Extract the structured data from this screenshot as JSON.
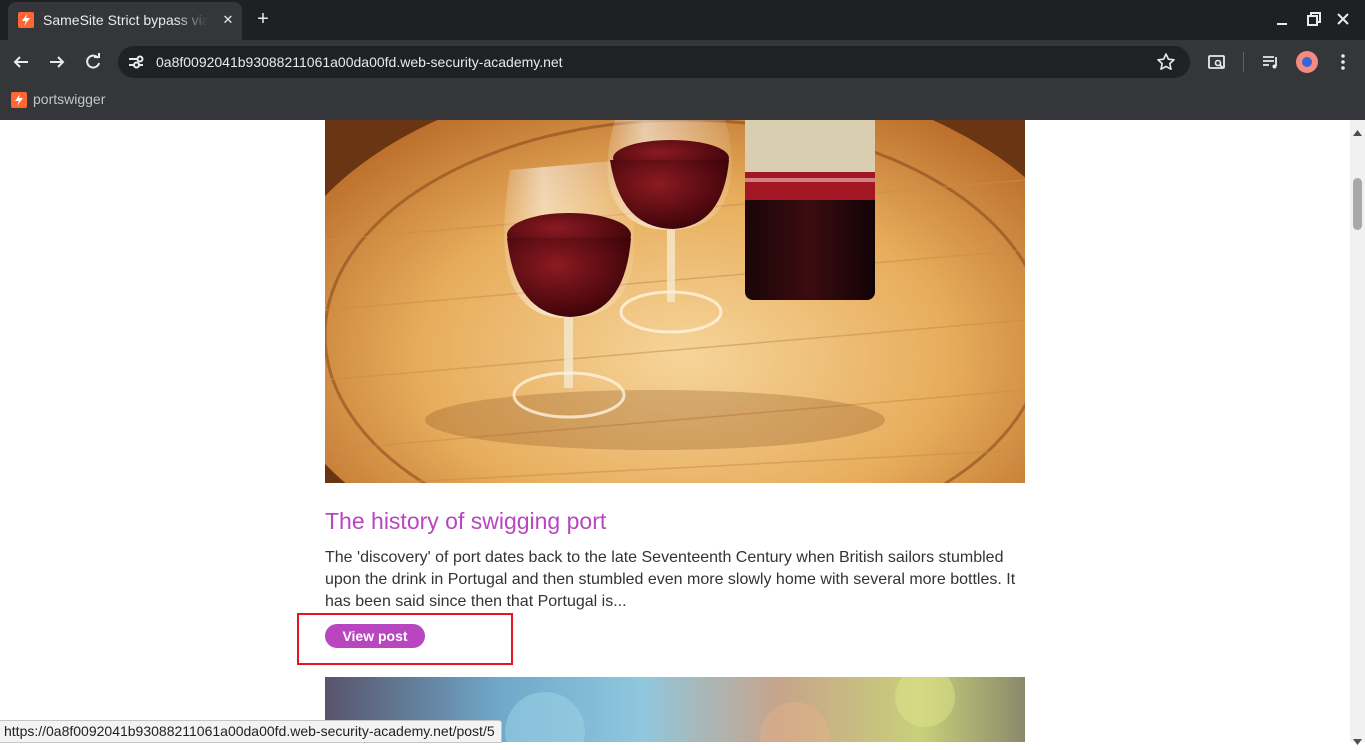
{
  "browser": {
    "tab": {
      "title": "SameSite Strict bypass via",
      "close_glyph": "✕"
    },
    "new_tab_glyph": "+",
    "address": {
      "url": "0a8f0092041b93088211061a00da00fd.web-security-academy.net"
    },
    "bookmarks": [
      {
        "label": "portswigger",
        "icon": "portswigger-icon"
      }
    ],
    "status_url": "https://0a8f0092041b93088211061a00da00fd.web-security-academy.net/post/5"
  },
  "post": {
    "title": "The history of swigging port",
    "summary": "The 'discovery' of port dates back to the late Seventeenth Century when British sailors stumbled upon the drink in Portugal and then stumbled even more slowly home with several more bottles. It has been said since then that Portugal is...",
    "button_label": "View post"
  },
  "colors": {
    "accent": "#b946c0",
    "highlight": "#e8141f",
    "chrome_dark": "#1f2023",
    "chrome": "#35363a"
  }
}
